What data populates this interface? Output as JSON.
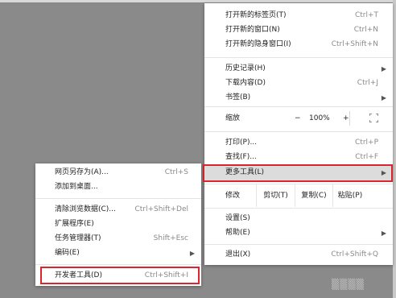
{
  "main_menu": {
    "new_tab": {
      "label": "打开新的标签页(T)",
      "shortcut": "Ctrl+T"
    },
    "new_window": {
      "label": "打开新的窗口(N)",
      "shortcut": "Ctrl+N"
    },
    "new_incognito": {
      "label": "打开新的隐身窗口(I)",
      "shortcut": "Ctrl+Shift+N"
    },
    "history": {
      "label": "历史记录(H)"
    },
    "downloads": {
      "label": "下载内容(D)",
      "shortcut": "Ctrl+J"
    },
    "bookmarks": {
      "label": "书签(B)"
    },
    "zoom": {
      "label": "缩放",
      "minus": "−",
      "value": "100%",
      "plus": "+"
    },
    "print": {
      "label": "打印(P)...",
      "shortcut": "Ctrl+P"
    },
    "find": {
      "label": "查找(F)...",
      "shortcut": "Ctrl+F"
    },
    "more_tools": {
      "label": "更多工具(L)"
    },
    "edit": {
      "label": "修改",
      "cut": "剪切(T)",
      "copy": "复制(C)",
      "paste": "粘贴(P)"
    },
    "settings": {
      "label": "设置(S)"
    },
    "help": {
      "label": "帮助(E)"
    },
    "exit": {
      "label": "退出(X)",
      "shortcut": "Ctrl+Shift+Q"
    }
  },
  "sub_menu": {
    "save_page": {
      "label": "网页另存为(A)...",
      "shortcut": "Ctrl+S"
    },
    "add_desktop": {
      "label": "添加到桌面..."
    },
    "clear_data": {
      "label": "清除浏览数据(C)...",
      "shortcut": "Ctrl+Shift+Del"
    },
    "extensions": {
      "label": "扩展程序(E)"
    },
    "task_manager": {
      "label": "任务管理器(T)",
      "shortcut": "Shift+Esc"
    },
    "encoding": {
      "label": "编码(E)"
    },
    "dev_tools": {
      "label": "开发者工具(D)",
      "shortcut": "Ctrl+Shift+I"
    }
  },
  "colors": {
    "highlight_border": "#d8262c",
    "selected_row": "#dcdcdc"
  }
}
